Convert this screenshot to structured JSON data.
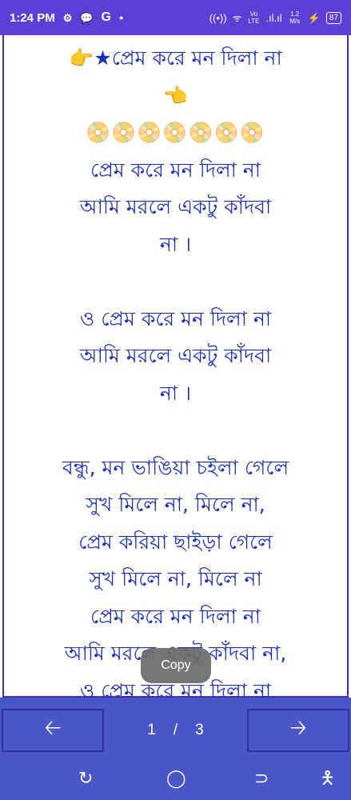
{
  "status_bar": {
    "time": "1:24 PM",
    "left_icons": [
      "gear-icon",
      "chat-bubble-icon",
      "google-g-icon",
      "dot-icon"
    ],
    "g_label": "G",
    "volte": "Vo LTE",
    "speed": "1.2 M/s",
    "battery": "87"
  },
  "lyrics": {
    "header": "👉★প্রেম করে মন দিলা না",
    "pointer": "👈",
    "discs": "📀📀📀📀📀📀📀",
    "lines": [
      "প্রেম করে মন দিলা না",
      "আমি মরলে একটু কাঁদবা",
      "না ।",
      "",
      "ও প্রেম করে মন দিলা না",
      "আমি মরলে একটু কাঁদবা",
      "না ।",
      "",
      "বন্ধু, মন ভাঙিয়া চইলা গেলে",
      "সুখ মিলে না, মিলে না,",
      "প্রেম করিয়া ছাইড়া গেলে",
      "সুখ মিলে না, মিলে না",
      "প্রেম করে মন দিলা না",
      "আমি মরলে একটু কাঁদবা না,",
      "ও প্রেম করে মন দিলা না"
    ]
  },
  "toast": {
    "label": "Copy"
  },
  "pager": {
    "current": "1",
    "separator": "/",
    "total": "3",
    "prev_icon": "arrow-left-icon",
    "next_icon": "arrow-right-icon"
  },
  "system_nav": [
    "recent-apps-icon",
    "home-icon",
    "back-icon",
    "accessibility-icon"
  ],
  "colors": {
    "status_bar": "#5b3fd6",
    "lyrics_text": "#1b2fb8",
    "frame_border": "#3b2fb0",
    "bottom_bar": "#4b57c9"
  }
}
